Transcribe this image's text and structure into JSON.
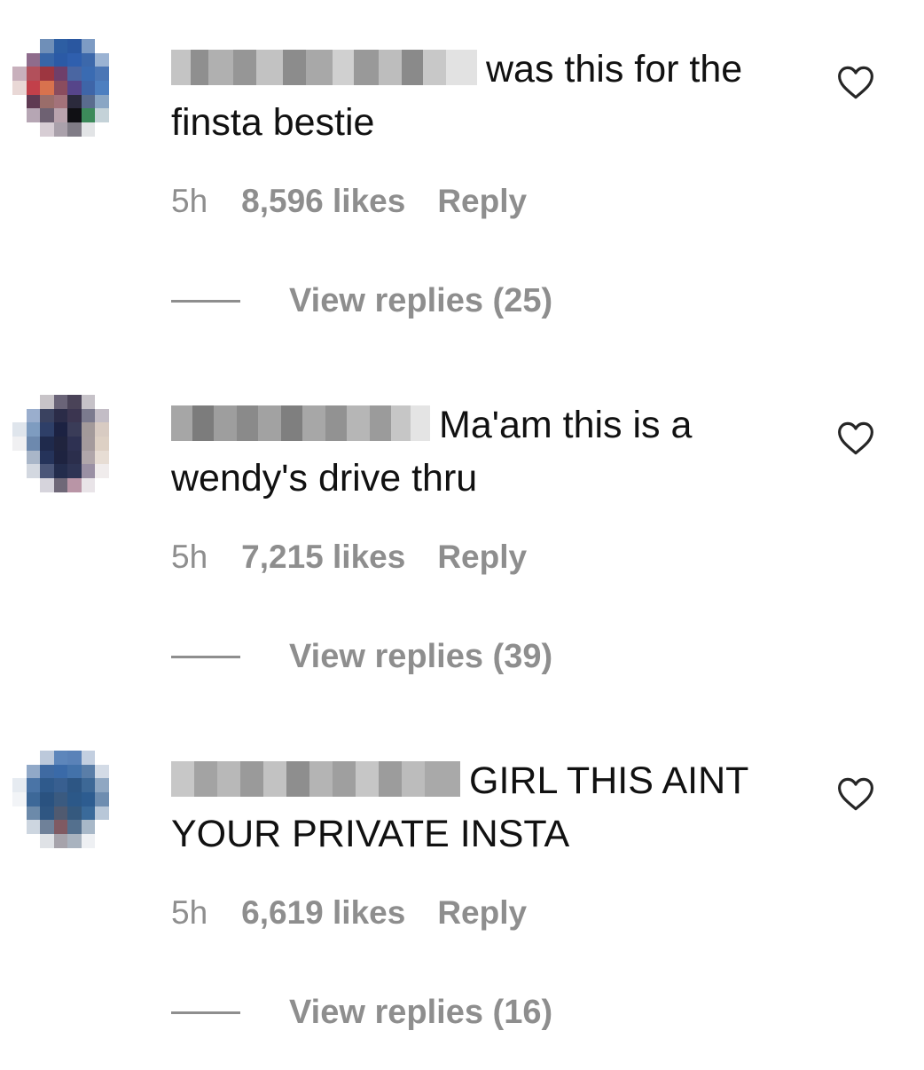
{
  "comments": [
    {
      "text": "was this for the finsta bestie",
      "time": "5h",
      "likes": "8,596 likes",
      "reply_label": "Reply",
      "view_replies": "View replies (25)"
    },
    {
      "text": "Ma'am this is a wendy's drive thru",
      "time": "5h",
      "likes": "7,215 likes",
      "reply_label": "Reply",
      "view_replies": "View replies (39)"
    },
    {
      "text": "GIRL THIS AINT YOUR PRIVATE INSTA",
      "time": "5h",
      "likes": "6,619 likes",
      "reply_label": "Reply",
      "view_replies": "View replies (16)"
    }
  ],
  "icons": {
    "like": "heart-outline-icon"
  },
  "colors": {
    "text": "#111111",
    "muted": "#8e8e8e",
    "background": "#ffffff"
  }
}
